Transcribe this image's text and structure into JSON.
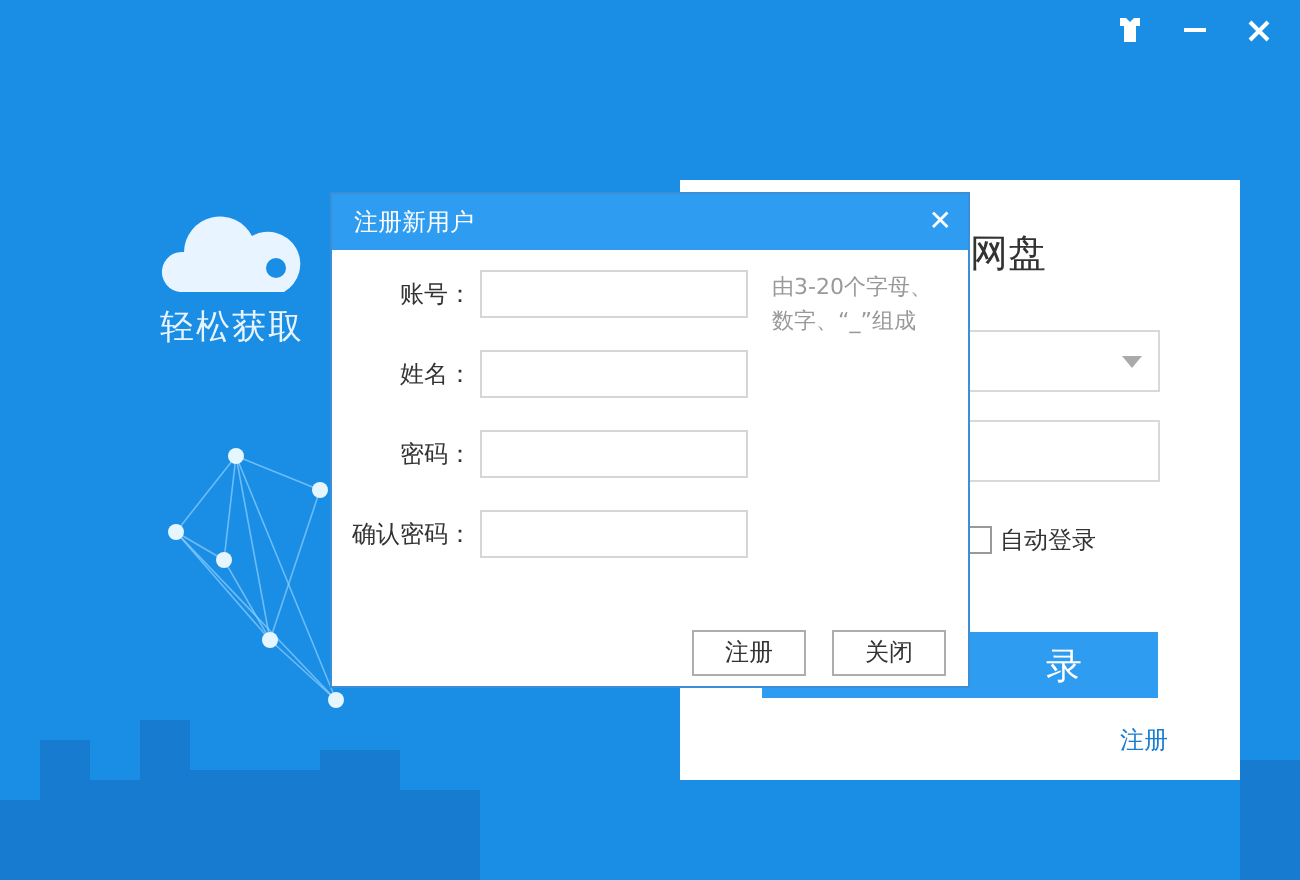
{
  "window": {
    "controls": [
      {
        "kind": "skin"
      },
      {
        "kind": "minimize"
      },
      {
        "kind": "close"
      }
    ]
  },
  "brand": {
    "slogan": "轻松获取"
  },
  "login_card": {
    "title": "网盘",
    "auto_login": {
      "label": "自动登录",
      "checked": false
    },
    "login_button": "录",
    "register_link": "注册"
  },
  "dialog": {
    "title": "注册新用户",
    "close": "✕",
    "fields": [
      {
        "label": "账号："
      },
      {
        "label": "姓名："
      },
      {
        "label": "密码："
      },
      {
        "label": "确认密码："
      }
    ],
    "hint": "由3-20个字母、数字、“_”组成",
    "buttons": [
      "注册",
      "关闭"
    ]
  }
}
